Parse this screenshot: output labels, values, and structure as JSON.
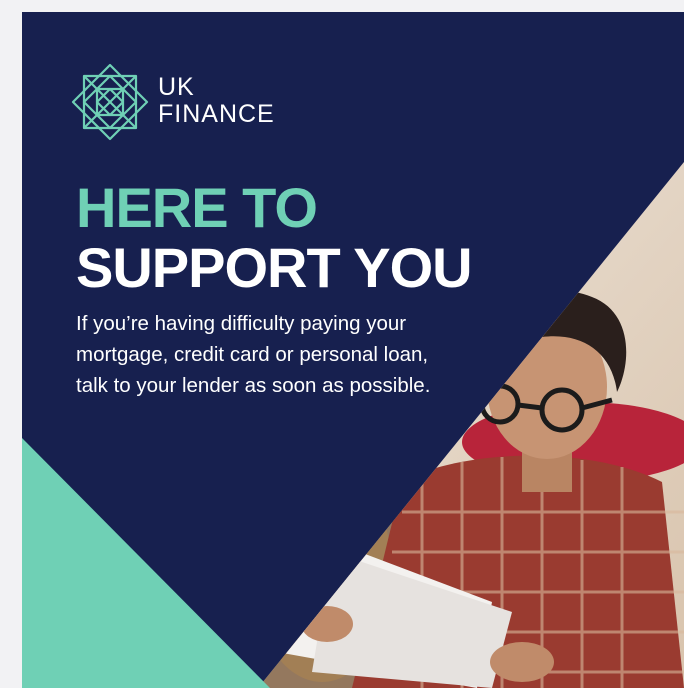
{
  "brand": {
    "line1": "UK",
    "line2": "FINANCE",
    "logo_icon": "uk-finance-geometric-logo"
  },
  "headline": {
    "line1": "HERE TO",
    "line2": "SUPPORT YOU"
  },
  "body": "If you’re having difficulty paying your mortgage, credit card or personal loan, talk to your lender as soon as possible.",
  "colors": {
    "navy": "#17204f",
    "mint": "#6fd0b5",
    "white": "#ffffff"
  },
  "photo": {
    "subject": "man-in-glasses-reading-letter"
  }
}
